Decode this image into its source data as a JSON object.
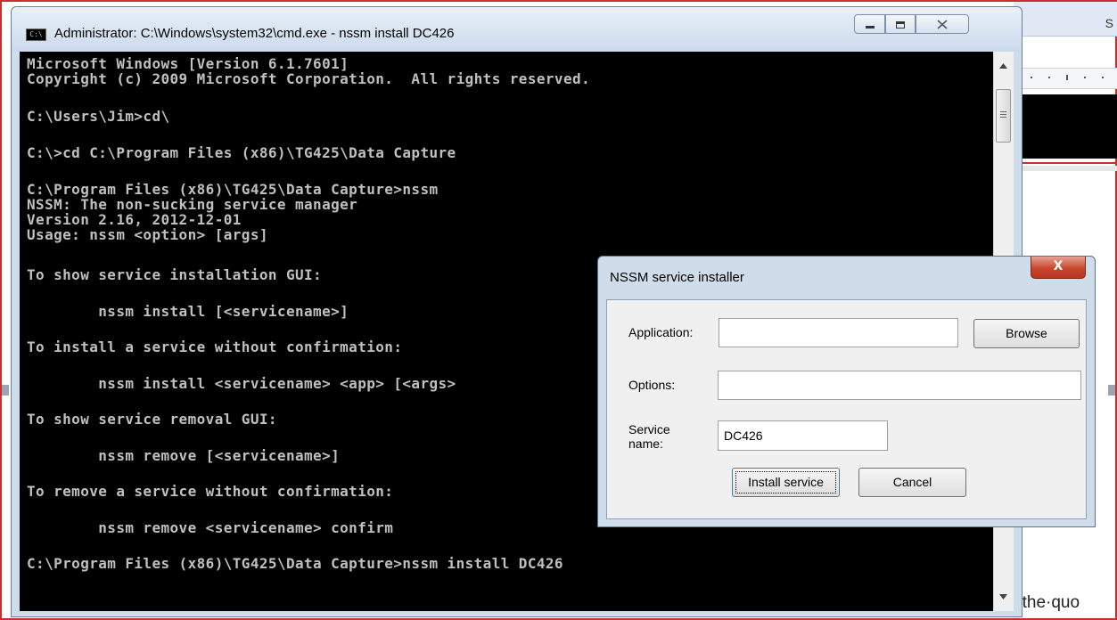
{
  "background_window": {
    "ribbon_letter": "S",
    "visible_text": "t·the·quo"
  },
  "cmd_window": {
    "title": "Administrator: C:\\Windows\\system32\\cmd.exe - nssm  install DC426",
    "icon_label": "C:\\",
    "buttons": {
      "minimize": "minimize",
      "maximize": "maximize",
      "close": "close"
    },
    "console_lines": [
      "Microsoft Windows [Version 6.1.7601]",
      "Copyright (c) 2009 Microsoft Corporation.  All rights reserved.",
      "C:\\Users\\Jim>cd\\",
      "C:\\>cd C:\\Program Files (x86)\\TG425\\Data Capture",
      "C:\\Program Files (x86)\\TG425\\Data Capture>nssm",
      "NSSM: The non-sucking service manager",
      "Version 2.16, 2012-12-01",
      "Usage: nssm <option> [args]",
      "To show service installation GUI:",
      "        nssm install [<servicename>]",
      "To install a service without confirmation:",
      "        nssm install <servicename> <app> [<args>",
      "To show service removal GUI:",
      "        nssm remove [<servicename>]",
      "To remove a service without confirmation:",
      "        nssm remove <servicename> confirm",
      "C:\\Program Files (x86)\\TG425\\Data Capture>nssm install DC426"
    ]
  },
  "nssm_dialog": {
    "title": "NSSM service installer",
    "close_glyph": "X",
    "application_label": "Application:",
    "application_value": "",
    "browse_label": "Browse",
    "options_label": "Options:",
    "options_value": "",
    "service_name_label": "Service name:",
    "service_name_value": "DC426",
    "install_label": "Install service",
    "cancel_label": "Cancel"
  }
}
